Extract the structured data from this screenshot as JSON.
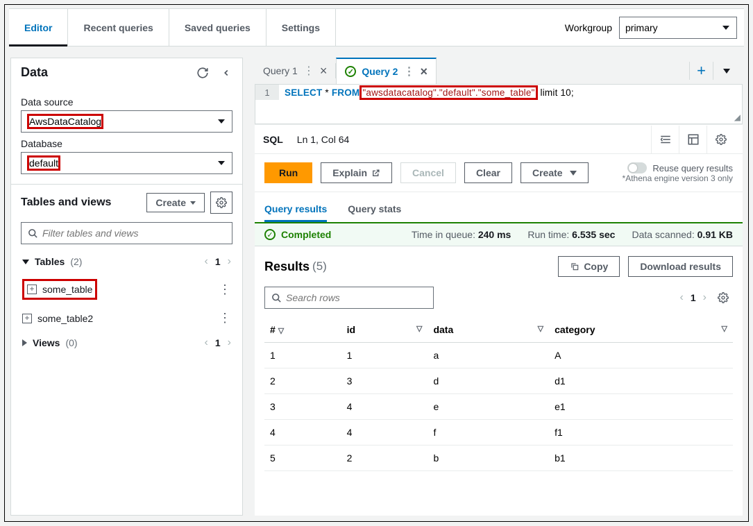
{
  "topnav": {
    "tabs": [
      "Editor",
      "Recent queries",
      "Saved queries",
      "Settings"
    ],
    "workgroup_label": "Workgroup",
    "workgroup_value": "primary"
  },
  "sidebar": {
    "title": "Data",
    "data_source_label": "Data source",
    "data_source_value": "AwsDataCatalog",
    "database_label": "Database",
    "database_value": "default",
    "tables_views_title": "Tables and views",
    "create_label": "Create",
    "filter_placeholder": "Filter tables and views",
    "tables_label": "Tables",
    "tables_count": "(2)",
    "tables_page": "1",
    "table_items": [
      "some_table",
      "some_table2"
    ],
    "views_label": "Views",
    "views_count": "(0)",
    "views_page": "1"
  },
  "query": {
    "tab1": "Query 1",
    "tab2": "Query 2",
    "line_no": "1",
    "kw_select": "SELECT",
    "star": " * ",
    "kw_from": "FROM",
    "highlighted": "\"awsdatacatalog\".\"default\".\"some_table\"",
    "rest": " limit 10;",
    "status_lang": "SQL",
    "status_pos": "Ln 1, Col 64",
    "actions": {
      "run": "Run",
      "explain": "Explain",
      "cancel": "Cancel",
      "clear": "Clear",
      "create": "Create"
    },
    "reuse": {
      "label": "Reuse query results",
      "note": "*Athena engine version 3 only"
    }
  },
  "results": {
    "tab_results": "Query results",
    "tab_stats": "Query stats",
    "status": "Completed",
    "time_queue_k": "Time in queue:",
    "time_queue_v": "240 ms",
    "run_time_k": "Run time:",
    "run_time_v": "6.535 sec",
    "data_scanned_k": "Data scanned:",
    "data_scanned_v": "0.91 KB",
    "title": "Results",
    "count": "(5)",
    "copy": "Copy",
    "download": "Download results",
    "search_placeholder": "Search rows",
    "page": "1",
    "columns": [
      "#",
      "id",
      "data",
      "category"
    ],
    "rows": [
      {
        "n": "1",
        "id": "1",
        "data": "a",
        "category": "A"
      },
      {
        "n": "2",
        "id": "3",
        "data": "d",
        "category": "d1"
      },
      {
        "n": "3",
        "id": "4",
        "data": "e",
        "category": "e1"
      },
      {
        "n": "4",
        "id": "4",
        "data": "f",
        "category": "f1"
      },
      {
        "n": "5",
        "id": "2",
        "data": "b",
        "category": "b1"
      }
    ]
  }
}
